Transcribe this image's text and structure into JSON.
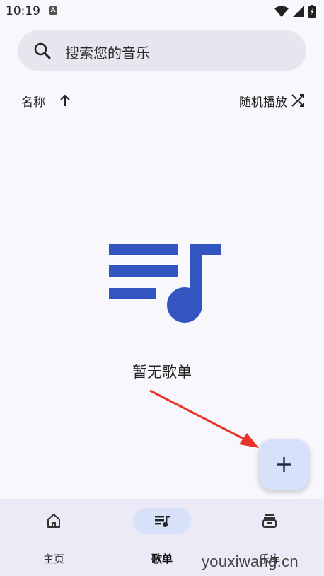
{
  "status_bar": {
    "time": "10:19",
    "notification_letter": "A"
  },
  "search": {
    "placeholder": "搜索您的音乐"
  },
  "sort": {
    "label": "名称",
    "shuffle_label": "随机播放"
  },
  "empty_state": {
    "message": "暂无歌单"
  },
  "nav": {
    "items": [
      {
        "label": "主页",
        "icon": "home-icon",
        "active": false
      },
      {
        "label": "歌单",
        "icon": "playlist-icon",
        "active": true
      },
      {
        "label": "乐库",
        "icon": "library-icon",
        "active": false
      }
    ]
  },
  "watermark": "youxiwang.cn",
  "colors": {
    "accent": "#3355c2",
    "fab_bg": "#d8e1fa",
    "nav_bg": "#eceaf7",
    "annotation": "#e8322c"
  }
}
